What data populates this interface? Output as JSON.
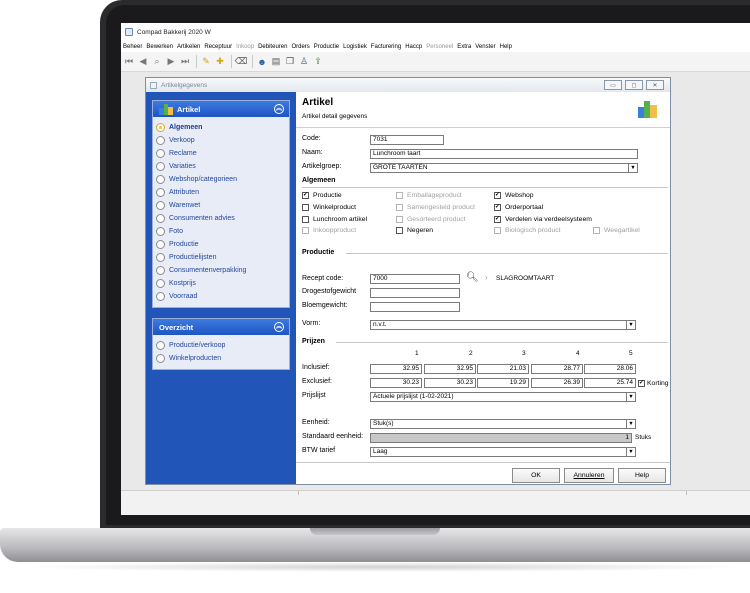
{
  "app": {
    "title": "Compad Bakkerij 2020 W",
    "menu": [
      "Beheer",
      "Bewerken",
      "Artikelen",
      "Receptuur",
      "Inkoop",
      "Debiteuren",
      "Orders",
      "Productie",
      "Logistiek",
      "Facturering",
      "Haccp",
      "Personeel",
      "Extra",
      "Venster",
      "Help"
    ],
    "menu_disabled": [
      "Inkoop",
      "Personeel"
    ]
  },
  "window": {
    "title": "Artikelgegevens"
  },
  "sidebar": {
    "artikel_panel": {
      "title": "Artikel",
      "items": [
        {
          "label": "Algemeen",
          "selected": true
        },
        {
          "label": "Verkoop"
        },
        {
          "label": "Reclame"
        },
        {
          "label": "Variaties"
        },
        {
          "label": "Webshop/categorieen"
        },
        {
          "label": "Attributen"
        },
        {
          "label": "Warenwet"
        },
        {
          "label": "Consumenten advies"
        },
        {
          "label": "Foto"
        },
        {
          "label": "Productie"
        },
        {
          "label": "Productielijsten"
        },
        {
          "label": "Consumentenverpakking"
        },
        {
          "label": "Kostprijs"
        },
        {
          "label": "Voorraad"
        }
      ]
    },
    "overzicht_panel": {
      "title": "Overzicht",
      "items": [
        {
          "label": "Productie/verkoop"
        },
        {
          "label": "Winkelproducten"
        }
      ]
    }
  },
  "header": {
    "title": "Artikel",
    "subtitle": "Artikel detail gegevens"
  },
  "fields": {
    "code_label": "Code:",
    "code_value": "7031",
    "naam_label": "Naam:",
    "naam_value": "Lunchroom taart",
    "artikelgroep_label": "Artikelgroep:",
    "artikelgroep_value": "GROTE TAARTEN"
  },
  "algemeen": {
    "title": "Algemeen",
    "checkboxes": [
      {
        "label": "Productie",
        "checked": true,
        "enabled": true
      },
      {
        "label": "Winkelproduct",
        "checked": false,
        "enabled": true
      },
      {
        "label": "Lunchroom artikel",
        "checked": false,
        "enabled": true
      },
      {
        "label": "Inkoopproduct",
        "checked": false,
        "enabled": false
      },
      {
        "label": "Emballageproduct",
        "checked": false,
        "enabled": false
      },
      {
        "label": "Samengesteld product",
        "checked": false,
        "enabled": false
      },
      {
        "label": "Gesorteerd product",
        "checked": false,
        "enabled": false
      },
      {
        "label": "Negeren",
        "checked": false,
        "enabled": true
      },
      {
        "label": "Webshop",
        "checked": true,
        "enabled": true
      },
      {
        "label": "Orderportaal",
        "checked": true,
        "enabled": true
      },
      {
        "label": "Verdelen via verdeelsysteem",
        "checked": true,
        "enabled": true
      },
      {
        "label": "Biologisch product",
        "checked": false,
        "enabled": false
      },
      {
        "label": "Weegartikel",
        "checked": false,
        "enabled": false
      }
    ]
  },
  "productie": {
    "title": "Productie",
    "recept_code_label": "Recept code:",
    "recept_code_value": "7000",
    "recept_name": "SLAGROOMTAART",
    "drogestofgewicht_label": "Drogestofgewicht",
    "drogestofgewicht_value": "",
    "bloemgewicht_label": "Bloemgewicht:",
    "bloemgewicht_value": "",
    "vorm_label": "Vorm:",
    "vorm_value": "n.v.t."
  },
  "prijzen": {
    "title": "Prijzen",
    "columns": [
      "1",
      "2",
      "3",
      "4",
      "5"
    ],
    "inclusief_label": "Inclusief:",
    "inclusief": [
      "32.95",
      "32.95",
      "21.03",
      "28.77",
      "28.06"
    ],
    "exclusief_label": "Exclusief:",
    "exclusief": [
      "30.23",
      "30.23",
      "19.29",
      "26.39",
      "25.74"
    ],
    "korting_label": "Korting",
    "korting_checked": true,
    "prijslijst_label": "Prijslijst",
    "prijslijst_value": "Actuele prijslijst (1-02-2021)"
  },
  "eenheid": {
    "eenheid_label": "Eenheid:",
    "eenheid_value": "Stuk(s)",
    "standaard_label": "Standaard eenheid:",
    "standaard_value": "1",
    "standaard_unit": "Stuks",
    "btw_label": "BTW tarief",
    "btw_value": "Laag"
  },
  "buttons": {
    "ok": "OK",
    "annuleren": "Annuleren",
    "help": "Help"
  },
  "colors": {
    "sidebar": "#2255b8",
    "panel_header": "#2a63d0",
    "accent": "#e4a324"
  }
}
